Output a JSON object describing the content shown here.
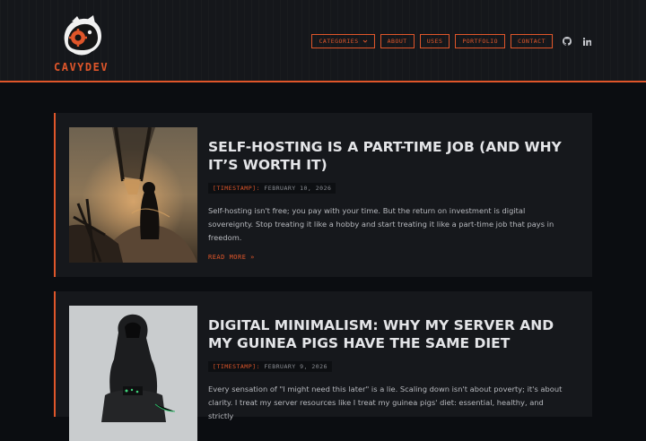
{
  "site": {
    "brand": "CAVYDEV"
  },
  "nav": {
    "categories": "CATEGORIES",
    "about": "ABOUT",
    "uses": "USES",
    "portfolio": "PORTFOLIO",
    "contact": "CONTACT"
  },
  "posts": [
    {
      "title": "Self-hosting is a part-time job (and why it’s worth it)",
      "meta_key": "[TIMESTAMP]:",
      "date": "FEBRUARY 10, 2026",
      "excerpt": "Self-hosting isn't free; you pay with your time. But the return on investment is digital sovereignty. Stop treating it like a hobby and start treating it like a part-time job that pays in freedom.",
      "read_more": "READ MORE »"
    },
    {
      "title": "Digital minimalism: Why my server and my guinea pigs have the same diet",
      "meta_key": "[TIMESTAMP]:",
      "date": "FEBRUARY 9, 2026",
      "excerpt": "Every sensation of \"I might need this later\" is a lie. Scaling down isn't about poverty; it's about clarity. I treat my server resources like I treat my guinea pigs' diet: essential, healthy, and strictly"
    }
  ],
  "colors": {
    "accent": "#e0562a",
    "background": "#0b0d11",
    "card": "#16181c"
  },
  "icons": {
    "dropdown": "chevron-down-icon",
    "github": "github-icon",
    "linkedin": "linkedin-icon"
  }
}
